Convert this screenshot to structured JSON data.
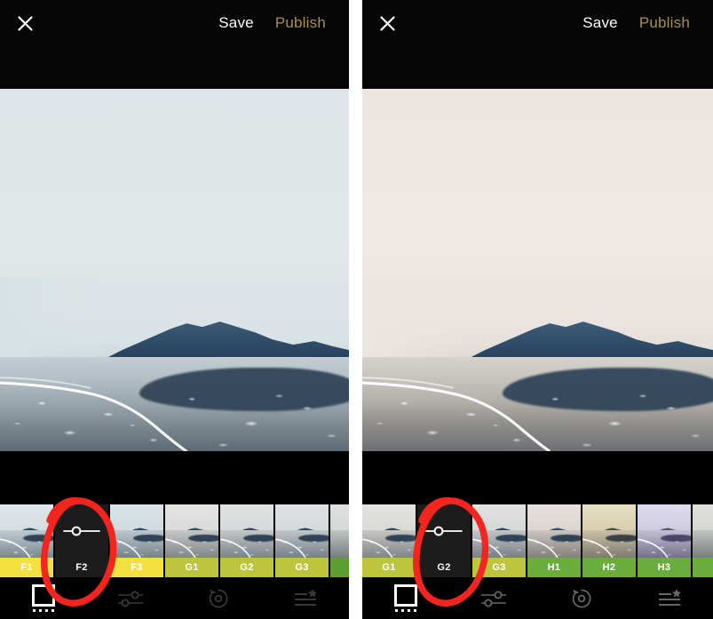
{
  "app": {
    "panel_count": 2,
    "background": "#ffffff"
  },
  "colors": {
    "publish": "#a8914f",
    "save": "#ffffff",
    "annotation": "#f4251f",
    "label_yellow": "#f2e13f",
    "label_yellow_green": "#bdc53c",
    "label_green": "#6aad3d",
    "selected_thumb_bg": "#1c1c1c"
  },
  "panels": [
    {
      "id": "panel-left",
      "topbar": {
        "close_icon": "close-x-icon",
        "save_label": "Save",
        "publish_label": "Publish"
      },
      "photo": {
        "alt": "foggy coastal beach with headland reflected in wet sand",
        "tone": "cool"
      },
      "filmstrip": {
        "selected": "F2",
        "thumbs": [
          {
            "label": "F1",
            "label_color": "#f2e13f",
            "tone": "cool",
            "selected": false
          },
          {
            "label": "F2",
            "label_color": "#f2e13f",
            "tone": "cool",
            "selected": true
          },
          {
            "label": "F3",
            "label_color": "#f2e13f",
            "tone": "cool",
            "selected": false
          },
          {
            "label": "G1",
            "label_color": "#bdc53c",
            "tone": "neutral",
            "selected": false
          },
          {
            "label": "G2",
            "label_color": "#bdc53c",
            "tone": "neutral",
            "selected": false
          },
          {
            "label": "G3",
            "label_color": "#bdc53c",
            "tone": "neutral",
            "selected": false
          },
          {
            "label": "",
            "label_color": "#5f9e33",
            "tone": "green",
            "selected": false
          }
        ]
      },
      "toolbar": {
        "items": [
          {
            "icon": "filter-frame-icon",
            "active": true,
            "dots": 4
          },
          {
            "icon": "adjust-sliders-icon",
            "active": false,
            "dots": 0
          },
          {
            "icon": "undo-revert-icon",
            "active": false,
            "dots": 0
          },
          {
            "icon": "presets-star-icon",
            "active": false,
            "dots": 0
          }
        ]
      },
      "annotation": {
        "shape": "hand-drawn-oval",
        "targets": "F2"
      }
    },
    {
      "id": "panel-right",
      "topbar": {
        "close_icon": "close-x-icon",
        "save_label": "Save",
        "publish_label": "Publish"
      },
      "photo": {
        "alt": "foggy coastal beach with headland, warm toned sky",
        "tone": "warm"
      },
      "filmstrip": {
        "selected": "G2",
        "thumbs": [
          {
            "label": "G1",
            "label_color": "#bdc53c",
            "tone": "neutral",
            "selected": false
          },
          {
            "label": "G2",
            "label_color": "#bdc53c",
            "tone": "neutral",
            "selected": true
          },
          {
            "label": "G3",
            "label_color": "#bdc53c",
            "tone": "neutral",
            "selected": false
          },
          {
            "label": "H1",
            "label_color": "#6aad3d",
            "tone": "warm",
            "selected": false
          },
          {
            "label": "H2",
            "label_color": "#6aad3d",
            "tone": "sepia",
            "selected": false
          },
          {
            "label": "H3",
            "label_color": "#6aad3d",
            "tone": "violet",
            "selected": false
          },
          {
            "label": "",
            "label_color": "#6aad3d",
            "tone": "neutral",
            "selected": false
          }
        ]
      },
      "toolbar": {
        "items": [
          {
            "icon": "filter-frame-icon",
            "active": true,
            "dots": 4
          },
          {
            "icon": "adjust-sliders-icon",
            "active": false,
            "dots": 0
          },
          {
            "icon": "undo-revert-icon",
            "active": false,
            "dots": 0
          },
          {
            "icon": "presets-star-icon",
            "active": false,
            "dots": 0
          }
        ]
      },
      "annotation": {
        "shape": "hand-drawn-oval",
        "targets": "G2"
      }
    }
  ]
}
